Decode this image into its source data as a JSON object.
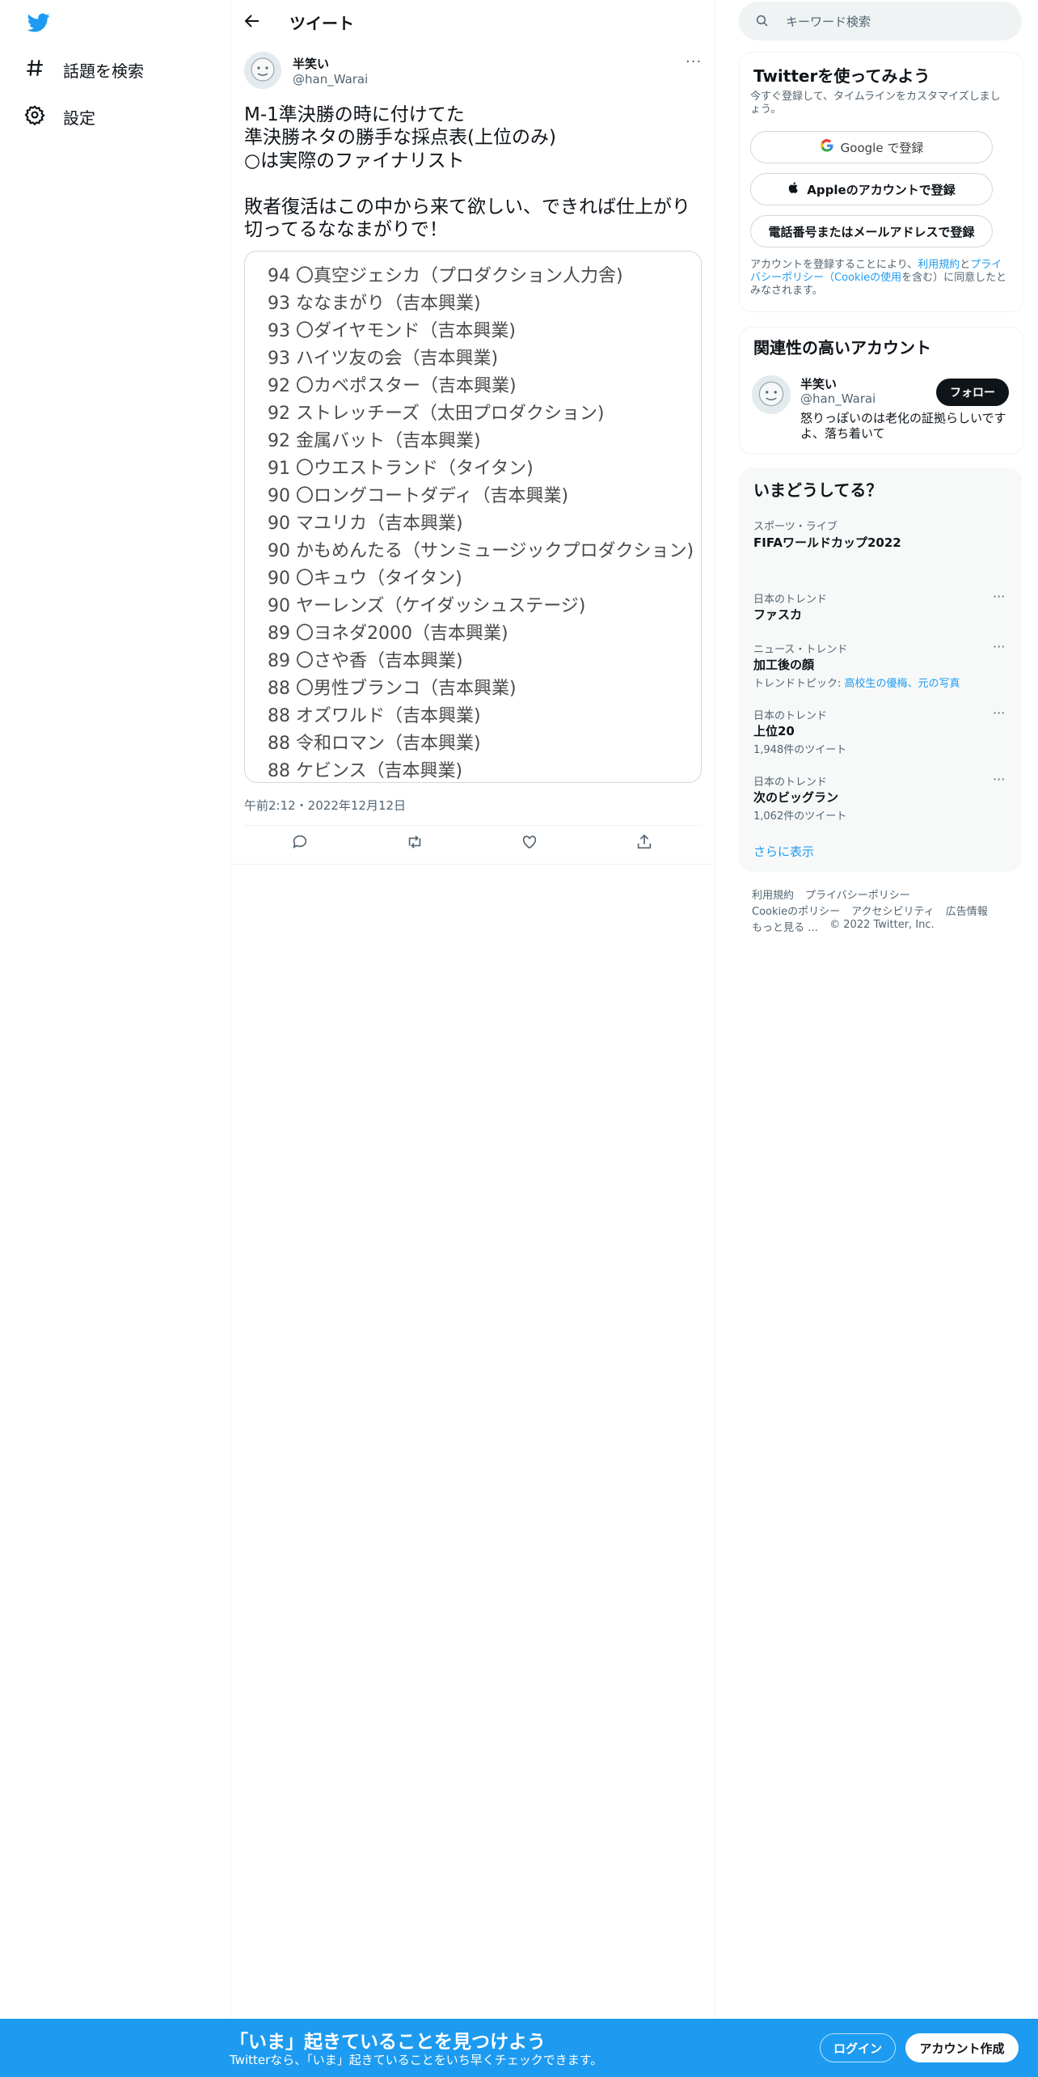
{
  "nav": {
    "logo_icon": "twitter-bird-icon",
    "items": [
      {
        "label": "話題を検索",
        "icon": "hashtag-icon"
      },
      {
        "label": "設定",
        "icon": "gear-icon"
      }
    ]
  },
  "header": {
    "title": "ツイート"
  },
  "tweet": {
    "author_name": "半笑い",
    "author_handle": "@han_Warai",
    "text": "M-1準決勝の時に付けてた\n準決勝ネタの勝手な採点表(上位のみ)\n○は実際のファイナリスト\n\n敗者復活はこの中から来て欲しい、できれば仕上がり切ってるななまがりで！",
    "rankings": [
      "94 〇真空ジェシカ（プロダクション人力舎)",
      "93 ななまがり（吉本興業)",
      "93 〇ダイヤモンド（吉本興業)",
      "93 ハイツ友の会（吉本興業)",
      "92 〇カベポスター（吉本興業)",
      "92 ストレッチーズ（太田プロダクション)",
      "92 金属バット（吉本興業)",
      "91 〇ウエストランド（タイタン)",
      "90 〇ロングコートダディ（吉本興業)",
      "90 マユリカ（吉本興業)",
      "90 かもめんたる（サンミュージックプロダクション)",
      "90 〇キュウ（タイタン)",
      "90 ヤーレンズ（ケイダッシュステージ)",
      "89 〇ヨネダ2000（吉本興業)",
      "89 〇さや香（吉本興業)",
      "88 〇男性ブランコ（吉本興業)",
      "88 オズワルド（吉本興業)",
      "88 令和ロマン（吉本興業)",
      "88 ケビンス（吉本興業)"
    ],
    "timestamp": "午前2:12・2022年12月12日"
  },
  "search": {
    "placeholder": "キーワード検索"
  },
  "signup": {
    "title": "Twitterを使ってみよう",
    "subtitle": "今すぐ登録して、タイムラインをカスタマイズしましょう。",
    "google_label": "Google で登録",
    "apple_label": "Appleのアカウントで登録",
    "phone_label": "電話番号またはメールアドレスで登録",
    "legal_prefix": "アカウントを登録することにより、",
    "legal_terms": "利用規約",
    "legal_and": "と",
    "legal_privacy": "プライバシーポリシー（Cookieの使用",
    "legal_suffix": "を含む）に同意したとみなされます。"
  },
  "related": {
    "title": "関連性の高いアカウント",
    "name": "半笑い",
    "handle": "@han_Warai",
    "bio": "怒りっぽいのは老化の証拠らしいですよ、落ち着いて",
    "follow_label": "フォロー"
  },
  "trends": {
    "title": "いまどうしてる？",
    "items": [
      {
        "category": "スポーツ・ライブ",
        "name": "FIFAワールドカップ2022",
        "sub": ""
      },
      {
        "category": "日本のトレンド",
        "name": "ファスカ",
        "sub": ""
      },
      {
        "category": "ニュース・トレンド",
        "name": "加工後の顔",
        "sub_prefix": "トレンドトピック: ",
        "sub_link": "高校生の優梅、元の写真"
      },
      {
        "category": "日本のトレンド",
        "name": "上位20",
        "sub": "1,948件のツイート"
      },
      {
        "category": "日本のトレンド",
        "name": "次のビッグラン",
        "sub": "1,062件のツイート"
      }
    ],
    "show_more": "さらに表示"
  },
  "footer": {
    "links_row1": [
      "利用規約",
      "プライバシーポリシー"
    ],
    "links_row2": [
      "Cookieのポリシー",
      "アクセシビリティ",
      "広告情報"
    ],
    "more": "もっと見る …",
    "copyright": "© 2022 Twitter, Inc."
  },
  "bottom_bar": {
    "title": "「いま」起きていることを見つけよう",
    "subtitle": "Twitterなら、「いま」起きていることをいち早くチェックできます。",
    "login_label": "ログイン",
    "signup_label": "アカウント作成"
  },
  "colors": {
    "accent": "#1d9bf0",
    "text": "#0f1419",
    "secondary": "#536471"
  }
}
